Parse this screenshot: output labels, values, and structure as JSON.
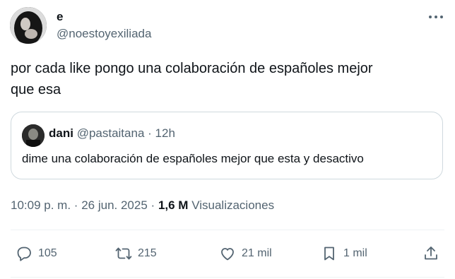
{
  "author": {
    "name": "e",
    "handle": "@noestoyexiliada"
  },
  "tweet": {
    "text_line1": "por cada like pongo una colaboración de españoles mejor",
    "text_line2": "que esa"
  },
  "quoted": {
    "name": "dani",
    "handle": "@pastaitana",
    "separator": "·",
    "time": "12h",
    "text": "dime una colaboración de españoles mejor que esta y desactivo"
  },
  "meta": {
    "time": "10:09 p. m.",
    "sep1": "·",
    "date": "26 jun. 2025",
    "sep2": "·",
    "views_count": "1,6 M",
    "views_label": "Visualizaciones"
  },
  "actions": {
    "replies": "105",
    "retweets": "215",
    "likes": "21 mil",
    "bookmarks": "1 mil"
  },
  "icons": {
    "reply": "reply-icon",
    "retweet": "retweet-icon",
    "like": "heart-icon",
    "bookmark": "bookmark-icon",
    "share": "share-icon",
    "more": "more-icon"
  },
  "colors": {
    "text": "#0f1419",
    "secondary": "#536471",
    "border": "#cfd9de"
  }
}
